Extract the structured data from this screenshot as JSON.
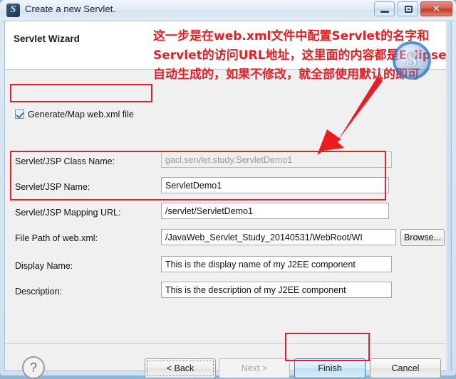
{
  "window": {
    "title": "Create a new Servlet.",
    "icon": "servlet-app-icon",
    "icon_glyph": "S",
    "controls": {
      "minimize": "minimize-button",
      "maximize": "restore-button",
      "close_glyph": "✕"
    }
  },
  "header": {
    "wizard_title": "Servlet Wizard"
  },
  "form": {
    "checkbox": {
      "label": "Generate/Map web.xml file",
      "checked": true
    },
    "fields": [
      {
        "label": "Servlet/JSP Class Name:",
        "value": "gacl.servlet.study.ServletDemo1",
        "disabled": true
      },
      {
        "label": "Servlet/JSP Name:",
        "value": "ServletDemo1",
        "disabled": false
      },
      {
        "label": "Servlet/JSP Mapping URL:",
        "value": "/servlet/ServletDemo1",
        "disabled": false
      },
      {
        "label": "File Path of web.xml:",
        "value": "/JavaWeb_Servlet_Study_20140531/WebRoot/WI",
        "disabled": false
      },
      {
        "label": "Display Name:",
        "value": "This is the display name of my J2EE component",
        "disabled": false
      },
      {
        "label": "Description:",
        "value": "This is the description of my J2EE component",
        "disabled": false
      }
    ],
    "browse_label": "Browse..."
  },
  "footer": {
    "help_glyph": "?",
    "buttons": [
      {
        "label": "< Back",
        "state": "focused"
      },
      {
        "label": "Next >",
        "state": "disabled"
      },
      {
        "label": "Finish",
        "state": "default"
      },
      {
        "label": "Cancel",
        "state": "normal"
      }
    ]
  },
  "annotation": {
    "text": "这一步是在web.xml文件中配置Servlet的名字和Servlet的访问URL地址，这里面的内容都是Eclipse自动生成的，如果不修改，就全部使用默认的即可",
    "color": "#ec1c24",
    "arrow": "red-arrow-pointing-to-servlet-name-field",
    "boxes": [
      "generate-map-webxml-checkbox",
      "servlet-name-and-mapping-fields",
      "finish-button"
    ]
  },
  "watermark": {
    "glyph": "S",
    "color": "#246ebe"
  }
}
